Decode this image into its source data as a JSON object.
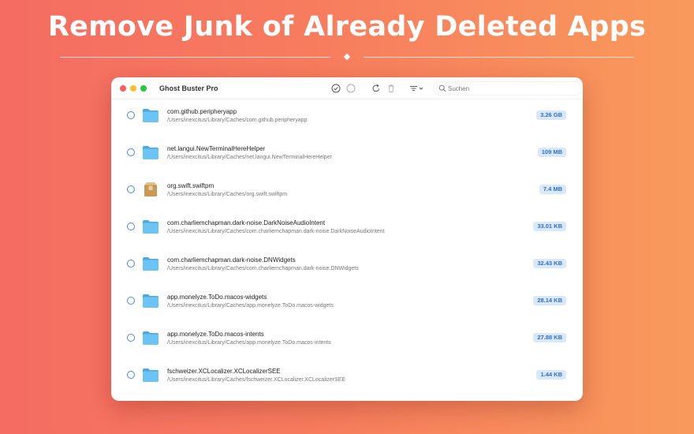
{
  "headline": "Remove Junk of Already Deleted Apps",
  "window": {
    "title": "Ghost Buster Pro",
    "toolbar": {
      "select_all_icon": "check-circle-icon",
      "deselect_icon": "circle-icon",
      "refresh_icon": "refresh-icon",
      "delete_icon": "trash-icon",
      "sort_icon": "sort-lines-icon"
    },
    "search": {
      "placeholder": "Suchen",
      "value": ""
    }
  },
  "items": [
    {
      "name": "com.github.peripheryapp",
      "path": "/Users/inexcitus/Library/Caches/com.github.peripheryapp",
      "size": "3.26 GB",
      "icon": "folder-icon"
    },
    {
      "name": "net.langui.NewTerminalHereHelper",
      "path": "/Users/inexcitus/Library/Caches/net.langui.NewTerminalHereHelper",
      "size": "109 MB",
      "icon": "folder-icon"
    },
    {
      "name": "org.swift.swiftpm",
      "path": "/Users/inexcitus/Library/Caches/org.swift.swiftpm",
      "size": "7.4 MB",
      "icon": "package-icon"
    },
    {
      "name": "com.charliemchapman.dark-noise.DarkNoiseAudioIntent",
      "path": "/Users/inexcitus/Library/Caches/com.charliemchapman.dark-noise.DarkNoiseAudioIntent",
      "size": "33.01 KB",
      "icon": "folder-icon"
    },
    {
      "name": "com.charliemchapman.dark-noise.DNWidgets",
      "path": "/Users/inexcitus/Library/Caches/com.charliemchapman.dark-noise.DNWidgets",
      "size": "32.43 KB",
      "icon": "folder-icon"
    },
    {
      "name": "app.monelyze.ToDo.macos-widgets",
      "path": "/Users/inexcitus/Library/Caches/app.monelyze.ToDo.macos-widgets",
      "size": "28.14 KB",
      "icon": "folder-icon"
    },
    {
      "name": "app.monelyze.ToDo.macos-intents",
      "path": "/Users/inexcitus/Library/Caches/app.monelyze.ToDo.macos-intents",
      "size": "27.88 KB",
      "icon": "folder-icon"
    },
    {
      "name": "fschweizer.XCLocalizer.XCLocalizerSEE",
      "path": "/Users/inexcitus/Library/Caches/fschweizer.XCLocalizer.XCLocalizerSEE",
      "size": "1.44 KB",
      "icon": "folder-icon"
    }
  ],
  "colors": {
    "background_start": "#f56c62",
    "background_end": "#f99a5c",
    "accent": "#4a86f5",
    "size_badge_bg": "#d9e8fb",
    "size_badge_text": "#2f6fd6",
    "folder": "#5ab8ee"
  }
}
